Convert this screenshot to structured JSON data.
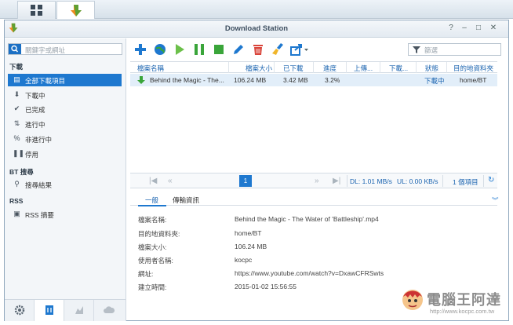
{
  "window": {
    "title": "Download Station"
  },
  "sidebar": {
    "search_placeholder": "關鍵字或網址",
    "section_download": "下載",
    "items": [
      {
        "label": "全部下載項目",
        "icon": "file-icon"
      },
      {
        "label": "下載中",
        "icon": "arrow-down-icon"
      },
      {
        "label": "已完成",
        "icon": "check-icon"
      },
      {
        "label": "進行中",
        "icon": "updown-arrows-icon"
      },
      {
        "label": "非進行中",
        "icon": "percent-icon"
      },
      {
        "label": "停用",
        "icon": "pause-icon"
      }
    ],
    "section_bt": "BT 搜尋",
    "bt_item": "搜尋結果",
    "section_rss": "RSS",
    "rss_item": "RSS 摘要"
  },
  "toolbar": {
    "filter_placeholder": "篩選"
  },
  "grid": {
    "columns": [
      "檔案名稱",
      "檔案大小",
      "已下載",
      "進度",
      "上傳...",
      "下載...",
      "狀態",
      "目的地資料夾"
    ],
    "rows": [
      {
        "name": "Behind the Magic - The...",
        "size": "106.24 MB",
        "downloaded": "3.42 MB",
        "progress": "3.2%",
        "upload": "",
        "download": "",
        "status": "下載中",
        "dest": "home/BT"
      }
    ]
  },
  "pager": {
    "current_page": "1",
    "dl_speed": "DL: 1.01 MB/s",
    "ul_speed": "UL: 0.00 KB/s",
    "count": "1 個項目"
  },
  "detail": {
    "tabs": [
      "一般",
      "傳輸資訊"
    ],
    "fields": [
      {
        "label": "檔案名稱:",
        "value": "Behind the Magic - The Water of 'Battleship'.mp4"
      },
      {
        "label": "目的地資料夾:",
        "value": "home/BT"
      },
      {
        "label": "檔案大小:",
        "value": "106.24 MB"
      },
      {
        "label": "使用者名稱:",
        "value": "kocpc"
      },
      {
        "label": "網址:",
        "value": "https://www.youtube.com/watch?v=DxawCFRSwts"
      },
      {
        "label": "建立時間:",
        "value": "2015-01-02 15:56:55"
      }
    ]
  },
  "watermark": {
    "brand": "電腦王阿達",
    "url": "http://www.kocpc.com.tw"
  },
  "colors": {
    "accent": "#1e78cf",
    "link": "#1b64b0",
    "status_green": "#3aa53a",
    "delete_red": "#d9443a"
  }
}
